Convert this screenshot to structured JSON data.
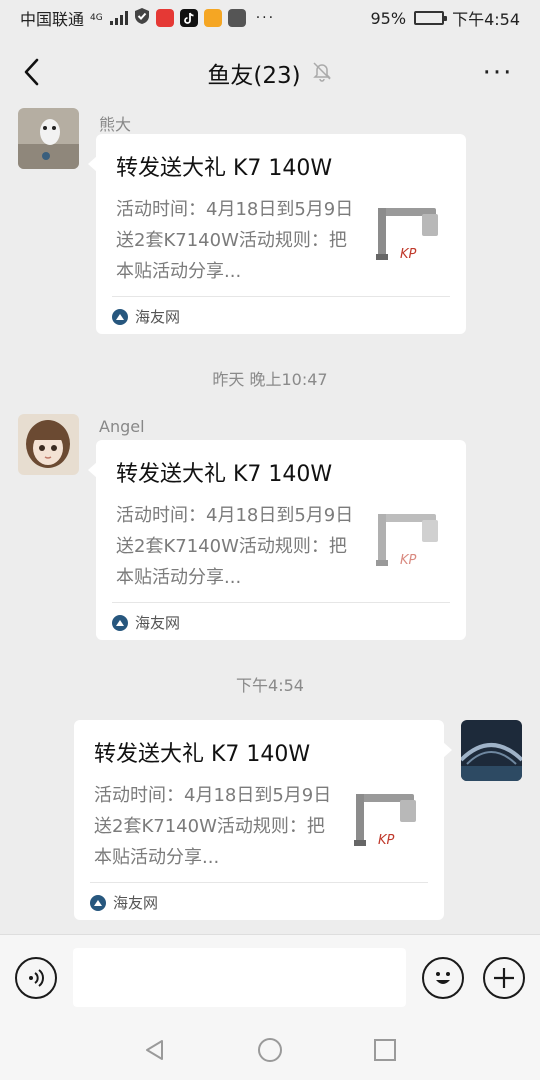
{
  "status_bar": {
    "carrier": "中国联通",
    "network": "4G",
    "battery": "95%",
    "battery_level": 0.95,
    "time": "下午4:54",
    "more": "···"
  },
  "nav": {
    "title": "鱼友(23)",
    "more": "···",
    "muted_icon": "bell-off-icon"
  },
  "messages": [
    {
      "sender": "熊大",
      "card": {
        "title": "转发送大礼 K7 140W",
        "desc": "活动时间：4月18日到5月9日送2套K7140W活动规则：把本贴活动分享...",
        "source": "海友网"
      }
    },
    {
      "time": "昨天 晚上10:47"
    },
    {
      "sender": "Angel",
      "card": {
        "title": "转发送大礼 K7 140W",
        "desc": "活动时间：4月18日到5月9日送2套K7140W活动规则：把本贴活动分享...",
        "source": "海友网"
      }
    },
    {
      "time": "下午4:54"
    },
    {
      "card": {
        "title": "转发送大礼 K7 140W",
        "desc": "活动时间：4月18日到5月9日送2套K7140W活动规则：把本贴活动分享...",
        "source": "海友网"
      }
    }
  ],
  "input_bar": {
    "voice_icon": "voice-icon",
    "emoji_icon": "emoji-icon",
    "plus_icon": "plus-icon",
    "placeholder": ""
  },
  "thumb_brand": "KP",
  "colors": {
    "background": "#ededed",
    "card": "#ffffff",
    "source_icon": "#27577e"
  }
}
